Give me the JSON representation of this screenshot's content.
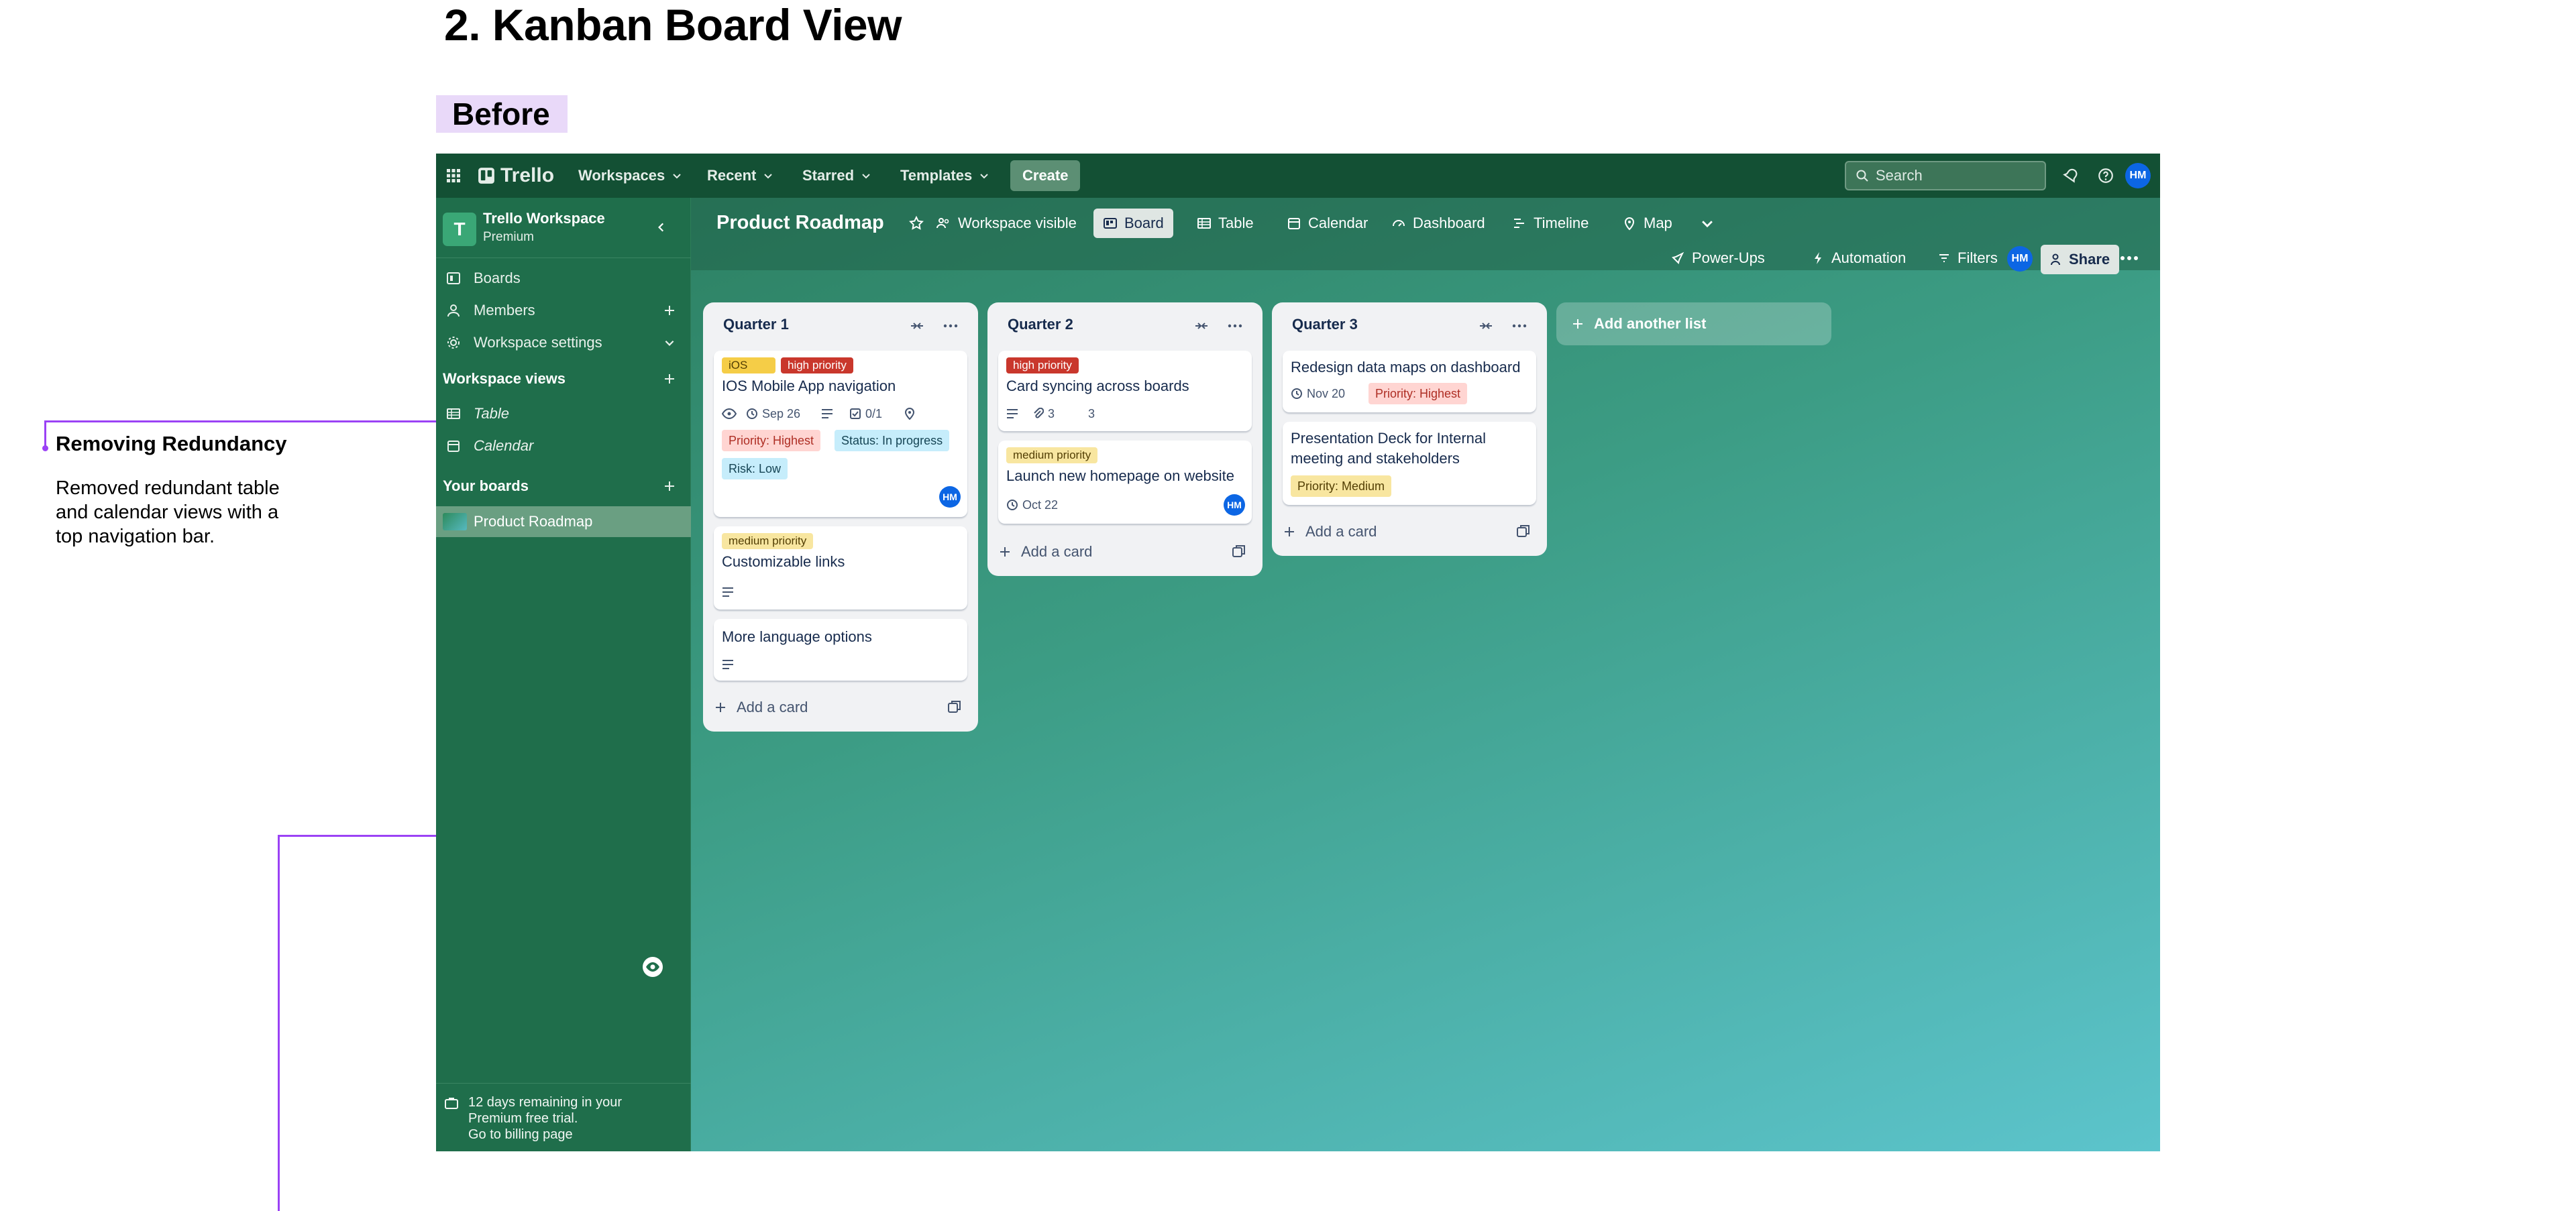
{
  "page": {
    "heading": "2. Kanban Board View",
    "before_label": "Before",
    "annotation_title": "Removing Redundancy",
    "annotation_body": "Removed redundant table and calendar views with a top navigation bar."
  },
  "topbar": {
    "brand": "Trello",
    "menus": [
      "Workspaces",
      "Recent",
      "Starred",
      "Templates"
    ],
    "create_label": "Create",
    "search_placeholder": "Search",
    "user_initials": "HM"
  },
  "sidebar": {
    "workspace_initial": "T",
    "workspace_name": "Trello Workspace",
    "workspace_plan": "Premium",
    "nav": [
      "Boards",
      "Members",
      "Workspace settings"
    ],
    "views_heading": "Workspace views",
    "views": [
      "Table",
      "Calendar"
    ],
    "boards_heading": "Your boards",
    "active_board": "Product Roadmap",
    "trial_text": "12 days remaining in your Premium free trial.",
    "billing_link": "Go to billing page"
  },
  "boardbar": {
    "title": "Product Roadmap",
    "visibility": "Workspace visible",
    "views": [
      "Board",
      "Table",
      "Calendar",
      "Dashboard",
      "Timeline",
      "Map"
    ],
    "power_ups": "Power-Ups",
    "automation": "Automation",
    "filters": "Filters",
    "member_initials": "HM",
    "share": "Share"
  },
  "lists": [
    {
      "title": "Quarter 1",
      "cards": [
        {
          "labels": [
            "iOS",
            "high priority"
          ],
          "title": "IOS Mobile App navigation",
          "due": "Sep 26",
          "checklist": "0/1",
          "fields": [
            "Priority: Highest",
            "Status: In progress",
            "Risk: Low"
          ],
          "member": "HM"
        },
        {
          "labels": [
            "medium priority"
          ],
          "title": "Customizable links"
        },
        {
          "title": "More language options"
        }
      ],
      "add_label": "Add a card"
    },
    {
      "title": "Quarter 2",
      "cards": [
        {
          "labels": [
            "high priority"
          ],
          "title": "Card syncing across boards",
          "attachments": "3",
          "comments": "3"
        },
        {
          "labels": [
            "medium priority"
          ],
          "title": "Launch new homepage on website",
          "due": "Oct 22",
          "member": "HM"
        }
      ],
      "add_label": "Add a card"
    },
    {
      "title": "Quarter 3",
      "cards": [
        {
          "title": "Redesign data maps on dashboard",
          "due": "Nov 20",
          "fields": [
            "Priority: Highest"
          ]
        },
        {
          "title_lines": [
            "Presentation Deck for Internal",
            "meeting and stakeholders"
          ],
          "fields": [
            "Priority: Medium"
          ]
        }
      ],
      "add_label": "Add a card"
    }
  ],
  "add_list_label": "Add another list",
  "colors": {
    "topbar": "#135034",
    "sidebar": "#1f6e4b",
    "accent_annotation": "#9b42f5",
    "label_red": "#c9372c",
    "label_yellow": "#f5cd47"
  }
}
